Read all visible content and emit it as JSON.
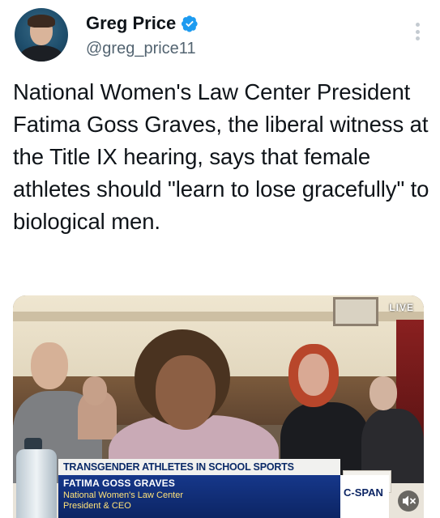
{
  "author": {
    "display_name": "Greg Price",
    "handle": "@greg_price11",
    "verified": true,
    "verified_color": "#1d9bf0"
  },
  "tweet": {
    "text": "National Women's Law Center President Fatima Goss Graves, the liberal witness at the Title IX hearing, says that female athletes should \"learn to lose gracefully\" to biological men."
  },
  "media": {
    "live_badge": "LIVE",
    "chyron": {
      "topic": "TRANSGENDER ATHLETES IN SCHOOL SPORTS",
      "name": "FATIMA GOSS GRAVES",
      "organization": "National Women's Law Center",
      "title": "President & CEO",
      "network": "C-SPAN",
      "accent_color": "#0c2564"
    },
    "mute_icon": "speaker-muted-icon"
  },
  "icons": {
    "more": "more-vertical-icon",
    "verified": "verified-badge-icon"
  }
}
